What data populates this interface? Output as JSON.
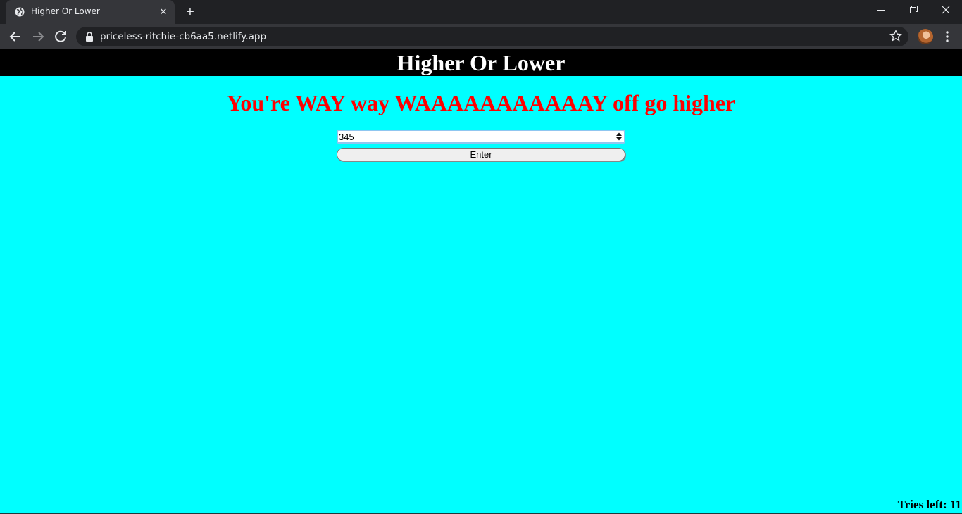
{
  "browser": {
    "tab_title": "Higher Or Lower",
    "url": "priceless-ritchie-cb6aa5.netlify.app"
  },
  "page": {
    "header_title": "Higher Or Lower",
    "message": "You're WAY way WAAAAAAAAAAAY off go higher",
    "guess_value": "345",
    "enter_label": "Enter",
    "tries_label": "Tries left:",
    "tries_value": "11"
  },
  "colors": {
    "background": "#00ffff",
    "header_bg": "#000000",
    "message": "#ff0000"
  }
}
